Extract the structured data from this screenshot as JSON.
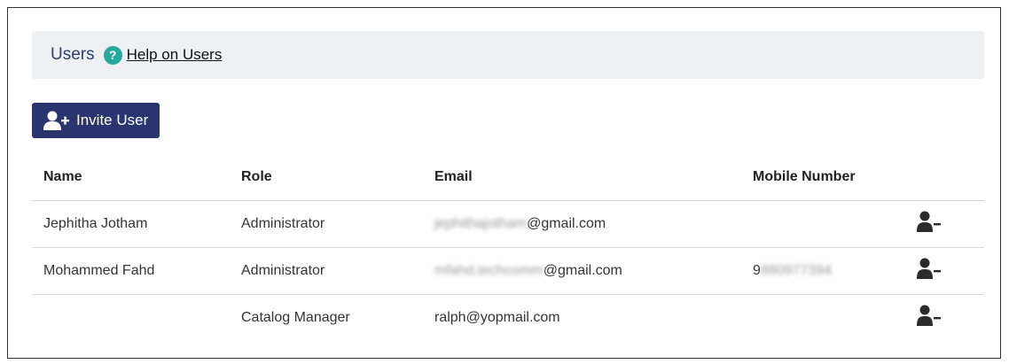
{
  "header": {
    "title": "Users",
    "help_link": "Help on Users"
  },
  "toolbar": {
    "invite_label": "Invite User"
  },
  "table": {
    "columns": [
      "Name",
      "Role",
      "Email",
      "Mobile Number"
    ],
    "rows": [
      {
        "name": "Jephitha Jotham",
        "role": "Administrator",
        "email_hidden": "jephithajotham",
        "email_domain": "@gmail.com",
        "mobile_prefix": "",
        "mobile_hidden": ""
      },
      {
        "name": "Mohammed Fahd",
        "role": "Administrator",
        "email_hidden": "mfahd.techcomm",
        "email_domain": "@gmail.com",
        "mobile_prefix": "9",
        "mobile_hidden": "880977394"
      },
      {
        "name": "",
        "role": "Catalog Manager",
        "email_hidden": "",
        "email_domain": "ralph@yopmail.com",
        "mobile_prefix": "",
        "mobile_hidden": ""
      }
    ]
  },
  "colors": {
    "accent": "#2a3570",
    "help": "#27a9a0",
    "header_bg": "#eef1f4"
  },
  "icons": {
    "help": "question-circle-icon",
    "invite": "user-plus-icon",
    "remove": "user-minus-icon"
  }
}
